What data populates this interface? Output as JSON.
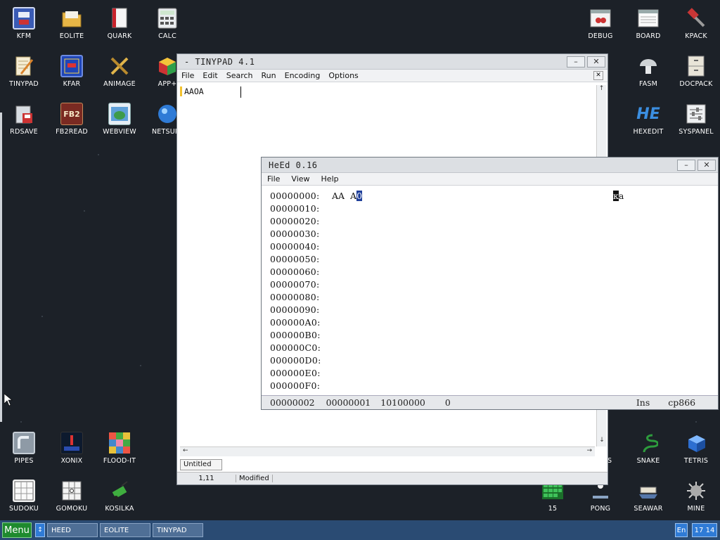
{
  "desktop": {
    "icons_top_left": [
      "KFM",
      "EOLITE",
      "QUARK",
      "CALC",
      "TINYPAD",
      "KFAR",
      "ANIMAGE",
      "APP+",
      "RDSAVE",
      "FB2READ",
      "WEBVIEW",
      "NETSURF"
    ],
    "icons_top_right": [
      "DEBUG",
      "BOARD",
      "KPACK",
      "FASM",
      "DOCPACK",
      "HEXEDIT",
      "SYSPANEL"
    ],
    "icons_bottom_left": [
      "PIPES",
      "XONIX",
      "FLOOD-IT",
      "SUDOKU",
      "GOMOKU",
      "KOSILKA"
    ],
    "icons_bottom_right": [
      "SNAKE",
      "TETRIS",
      "15",
      "PONG",
      "SEAWAR",
      "MINE"
    ],
    "icon_fb2_text": "FB2",
    "icon_hexedit_text": "HE",
    "icon_partial_s": "S"
  },
  "tinypad": {
    "title": "- TINYPAD 4.1",
    "menu": [
      "File",
      "Edit",
      "Search",
      "Run",
      "Encoding",
      "Options"
    ],
    "text_content": "AAOA",
    "tab_label": "Untitled",
    "status_position": "1,11",
    "status_modified": "Modified"
  },
  "heed": {
    "title": "HeEd 0.16",
    "menu": [
      "File",
      "View",
      "Help"
    ],
    "offsets": [
      "00000000:",
      "00000010:",
      "00000020:",
      "00000030:",
      "00000040:",
      "00000050:",
      "00000060:",
      "00000070:",
      "00000080:",
      "00000090:",
      "000000A0:",
      "000000B0:",
      "000000C0:",
      "000000D0:",
      "000000E0:",
      "000000F0:"
    ],
    "row0_hex_a": "AA",
    "row0_hex_b": "A",
    "row0_hex_cursor": "0",
    "row0_ascii_a": "к",
    "row0_ascii_b": "a",
    "status": {
      "offset": "00000002",
      "value": "00000001",
      "binary": "10100000",
      "decimal": "0",
      "mode": "Ins",
      "codepage": "cp866"
    }
  },
  "taskbar": {
    "menu_label": "Menu",
    "tasks": [
      "HEED",
      "EOLITE",
      "TINYPAD"
    ],
    "lang": "En",
    "clock": "17 14"
  },
  "colors": {
    "desktop_bg": "#1c2128",
    "taskbar_bg": "#2a4b73",
    "menu_button": "#1e8a2e",
    "selection": "#1f3f9a"
  }
}
